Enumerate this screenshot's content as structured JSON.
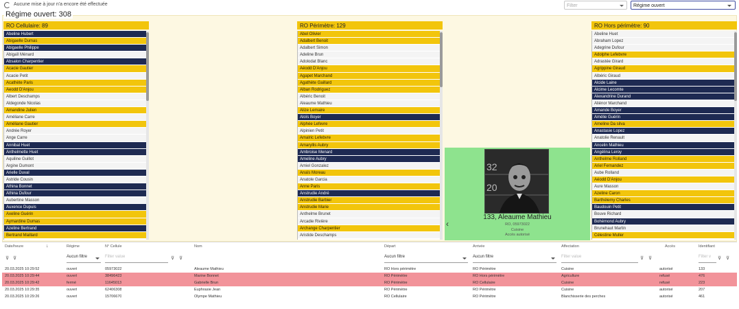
{
  "topbar": {
    "status": "Aucune mise à jour n'a encore été effectuée",
    "filter_placeholder": "Filter",
    "regime_selected": "Régime ouvert"
  },
  "main": {
    "title": "Régime ouvert: 308"
  },
  "columns": {
    "cellulaire": {
      "title": "RO Cellulaire: 89",
      "items": [
        {
          "name": "Abeline Hubert",
          "c": "n"
        },
        {
          "name": "Abigaelle Dumas",
          "c": "y"
        },
        {
          "name": "Abigaelle Philippe",
          "c": "n"
        },
        {
          "name": "Abigaïl Ménard",
          "c": "w"
        },
        {
          "name": "Absalon Charpentier",
          "c": "n"
        },
        {
          "name": "Acacie Gautier",
          "c": "y"
        },
        {
          "name": "Acacie Petit",
          "c": "w"
        },
        {
          "name": "Acathète Paris",
          "c": "y"
        },
        {
          "name": "Aeodd D'Anjou",
          "c": "y"
        },
        {
          "name": "Albert Deschamps",
          "c": "w"
        },
        {
          "name": "Aldegonde Nicolas",
          "c": "w"
        },
        {
          "name": "Amandine Julien",
          "c": "y"
        },
        {
          "name": "Améliane Carre",
          "c": "w"
        },
        {
          "name": "Améliane Gautier",
          "c": "y"
        },
        {
          "name": "Andrée Royer",
          "c": "w"
        },
        {
          "name": "Ange Carre",
          "c": "w"
        },
        {
          "name": "Annibal Huet",
          "c": "n"
        },
        {
          "name": "Anthelmette Huet",
          "c": "n"
        },
        {
          "name": "Aquiline Guillot",
          "c": "w"
        },
        {
          "name": "Argine Dumont",
          "c": "w"
        },
        {
          "name": "Arielle Duval",
          "c": "n"
        },
        {
          "name": "Astride Cousin",
          "c": "w"
        },
        {
          "name": "Athina Bonnet",
          "c": "n"
        },
        {
          "name": "Athina Dufour",
          "c": "n"
        },
        {
          "name": "Aubertine Masson",
          "c": "w"
        },
        {
          "name": "Auxence Dupuis",
          "c": "n"
        },
        {
          "name": "Axeline Guérin",
          "c": "y"
        },
        {
          "name": "Aymardine Dumas",
          "c": "y"
        },
        {
          "name": "Azeline Bertrand",
          "c": "n"
        },
        {
          "name": "Bertrand Maillard",
          "c": "y"
        }
      ]
    },
    "perimetre": {
      "title": "RO Périmètre: 129",
      "items": [
        {
          "name": "Abel Olivier",
          "c": "y"
        },
        {
          "name": "Adalbert Benoit",
          "c": "y"
        },
        {
          "name": "Adalbert Simon",
          "c": "w"
        },
        {
          "name": "Adeline Brun",
          "c": "w"
        },
        {
          "name": "Adolodat Blanc",
          "c": "w"
        },
        {
          "name": "Aéodd D'Anjou",
          "c": "y"
        },
        {
          "name": "Agapet Marchand",
          "c": "y"
        },
        {
          "name": "Agathète Gaillard",
          "c": "y"
        },
        {
          "name": "Alban Rodriguez",
          "c": "y"
        },
        {
          "name": "Albéric Benoit",
          "c": "w"
        },
        {
          "name": "Aleaume Mathieu",
          "c": "w"
        },
        {
          "name": "Alize Lemaire",
          "c": "y"
        },
        {
          "name": "Aloïs Boyer",
          "c": "n"
        },
        {
          "name": "Alphée Lefevre",
          "c": "y"
        },
        {
          "name": "Alpinien Petit",
          "c": "w"
        },
        {
          "name": "Amalric Lefebvre",
          "c": "y"
        },
        {
          "name": "Amaryllis Aubry",
          "c": "y"
        },
        {
          "name": "Ambroise Menard",
          "c": "n"
        },
        {
          "name": "Ameline Aubry",
          "c": "n"
        },
        {
          "name": "Amiel Gonzalez",
          "c": "w"
        },
        {
          "name": "Anaïs Moreau",
          "c": "y"
        },
        {
          "name": "Anatole Garcia",
          "c": "w"
        },
        {
          "name": "Anne Paris",
          "c": "y"
        },
        {
          "name": "Anstrudie André",
          "c": "n"
        },
        {
          "name": "Anstrudie Barbier",
          "c": "y"
        },
        {
          "name": "Anstrudie Marie",
          "c": "y"
        },
        {
          "name": "Anthelme Brunet",
          "c": "w"
        },
        {
          "name": "Arcadie Rivière",
          "c": "w"
        },
        {
          "name": "Archange Charpentier",
          "c": "y"
        },
        {
          "name": "Aristide Deschamps",
          "c": "w"
        }
      ]
    },
    "hors": {
      "title": "RO Hors périmètre: 90",
      "items": [
        {
          "name": "Abeline Huet",
          "c": "w"
        },
        {
          "name": "Abraham Lopez",
          "c": "w"
        },
        {
          "name": "Adegrine Dufour",
          "c": "w"
        },
        {
          "name": "Adolphe Lefebvre",
          "c": "y"
        },
        {
          "name": "Adrastée Girard",
          "c": "w"
        },
        {
          "name": "Agrippine Giraud",
          "c": "y"
        },
        {
          "name": "Albéric Giraud",
          "c": "w"
        },
        {
          "name": "Alcide Laine",
          "c": "n"
        },
        {
          "name": "Alcime Lecomte",
          "c": "n"
        },
        {
          "name": "Alexandrine Durand",
          "c": "n"
        },
        {
          "name": "Aliénor Marchand",
          "c": "w"
        },
        {
          "name": "Amande Boyer",
          "c": "n"
        },
        {
          "name": "Amélie Guérin",
          "c": "n"
        },
        {
          "name": "Ameline Da silva",
          "c": "y"
        },
        {
          "name": "Anastasie Lopez",
          "c": "n"
        },
        {
          "name": "Anatolie Renault",
          "c": "w"
        },
        {
          "name": "Ancelin Mathieu",
          "c": "n"
        },
        {
          "name": "Angélina Leroy",
          "c": "n"
        },
        {
          "name": "Anthelme Rolland",
          "c": "y"
        },
        {
          "name": "Ariel Fernandez",
          "c": "y"
        },
        {
          "name": "Aube Rolland",
          "c": "w"
        },
        {
          "name": "Aéodd D'Anjou",
          "c": "y"
        },
        {
          "name": "Aure Masson",
          "c": "w"
        },
        {
          "name": "Azeline Caron",
          "c": "y"
        },
        {
          "name": "Barthélemy Charles",
          "c": "y"
        },
        {
          "name": "Baudouin Petit",
          "c": "n"
        },
        {
          "name": "Bouve Richard",
          "c": "w"
        },
        {
          "name": "Bohémond Aubry",
          "c": "n"
        },
        {
          "name": "Brunehaut Martin",
          "c": "w"
        },
        {
          "name": "Célestine Muller",
          "c": "y"
        }
      ]
    }
  },
  "card": {
    "id_name": "133, Aleaume Mathieu",
    "code": "RO, 05973022",
    "affectation": "Cuisine",
    "acces": "Accès autorisé",
    "prev_icon": "chevron-left-icon"
  },
  "grid": {
    "headers": {
      "date": "Date/heure",
      "regime": "Régime",
      "cellule": "N° Cellule",
      "nom": "Nom",
      "depart": "Départ",
      "arrivee": "Arrivée",
      "affectation": "Affectation",
      "acces": "Accès",
      "identifiant": "Identifiant"
    },
    "filters": {
      "regime": "Aucun filtre",
      "cellule_ph": "Filter value",
      "depart": "Aucun filtre",
      "arrivee": "Aucun filtre",
      "affectation_ph": "Filter value",
      "identifiant_ph": "Filter v"
    },
    "rows": [
      {
        "date": "20.03.2025 10:29:52",
        "regime": "ouvert",
        "cellule": "05973022",
        "nom": "Aleaume Mathieu",
        "depart": "RO Hors périmètre",
        "arrivee": "RO Périmètre",
        "affectation": "Cuisine",
        "acces": "autorisé",
        "id": "133",
        "style": "white"
      },
      {
        "date": "20.03.2025 10:29:44",
        "regime": "ouvert",
        "cellule": "38496423",
        "nom": "Marine Bonnet",
        "depart": "RO Périmètre",
        "arrivee": "RO Hors périmètre",
        "affectation": "Agriculture",
        "acces": "refusé",
        "id": "476",
        "style": "red"
      },
      {
        "date": "20.03.2025 10:29:42",
        "regime": "fermé",
        "cellule": "11645013",
        "nom": "Gabrielle Brun",
        "depart": "RO Périmètre",
        "arrivee": "RO Cellulaire",
        "affectation": "Cuisine",
        "acces": "refusé",
        "id": "223",
        "style": "red"
      },
      {
        "date": "20.03.2025 10:29:35",
        "regime": "ouvert",
        "cellule": "62406308",
        "nom": "Euphrasie Jean",
        "depart": "RO Périmètre",
        "arrivee": "RO Périmètre",
        "affectation": "Cuisine",
        "acces": "autorisé",
        "id": "207",
        "style": "white"
      },
      {
        "date": "20.03.2025 10:29:26",
        "regime": "ouvert",
        "cellule": "15706670",
        "nom": "Olympe Mathieu",
        "depart": "RO Cellulaire",
        "arrivee": "RO Périmètre",
        "affectation": "Blanchisserie des perches",
        "acces": "autorisé",
        "id": "461",
        "style": "white"
      }
    ]
  }
}
